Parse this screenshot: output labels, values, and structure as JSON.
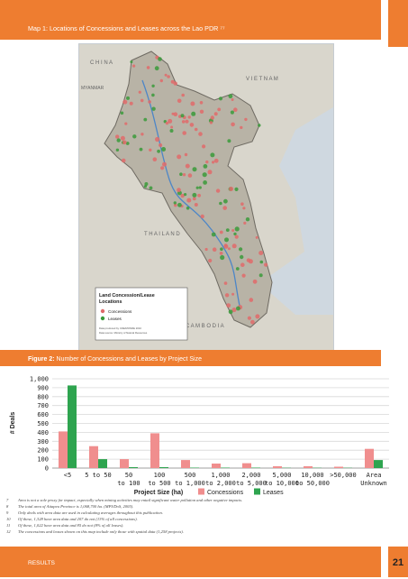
{
  "header": {
    "map_caption": "Map 1: Locations of Concessions and Leases across the Lao PDR ⁷⁷"
  },
  "map": {
    "labels": {
      "china": "C H I N A",
      "myanmar": "MYANMAR",
      "vietnam": "V I E T N A M",
      "thailand": "T H A I L A N D",
      "cambodia": "C A M B O D I A"
    },
    "legend": {
      "title_line1": "Land Concession/Lease",
      "title_line2": "Locations",
      "items": [
        {
          "label": "Concessions",
          "color": "#e06a6a"
        },
        {
          "label": "Leases",
          "color": "#3a9a3a"
        }
      ],
      "note1": "Data produced by CDE/MONRE 2010",
      "note2": "Data source: Ministry of Natural Resources"
    },
    "colors": {
      "land": "#eae3d2",
      "country": "#b8b3a6",
      "outline": "#6e6a62",
      "water": "#cfd8e0",
      "rivers": "#4d86c7",
      "concession": "#e06a6a",
      "lease": "#3a9a3a"
    }
  },
  "figure": {
    "label": "Figure 2:",
    "title": "Number of Concessions and Leases by Project Size"
  },
  "chart_data": {
    "type": "bar",
    "title": "",
    "xlabel": "Project Size (ha)",
    "ylabel": "# Deals",
    "ylim": [
      0,
      1000
    ],
    "yticks": [
      "0",
      "100",
      "200",
      "300",
      "400",
      "500",
      "600",
      "700",
      "800",
      "900",
      "1,000"
    ],
    "categories": [
      [
        "<5",
        ""
      ],
      [
        "5 to 50",
        ""
      ],
      [
        "50",
        "to 100"
      ],
      [
        "100",
        "to 500"
      ],
      [
        "500",
        "to 1,000"
      ],
      [
        "1,000",
        "to 2,000"
      ],
      [
        "2,000",
        "to 5,000"
      ],
      [
        "5,000",
        "to 10,000"
      ],
      [
        "10,000",
        "to 50,000"
      ],
      [
        ">50,000",
        ""
      ],
      [
        "Area",
        "Unknown"
      ]
    ],
    "series": [
      {
        "name": "Concessions",
        "color": "#f08e8e",
        "values": [
          410,
          245,
          100,
          390,
          90,
          50,
          55,
          20,
          20,
          15,
          215
        ]
      },
      {
        "name": "Leases",
        "color": "#2ea44f",
        "values": [
          925,
          100,
          10,
          10,
          5,
          5,
          5,
          3,
          3,
          3,
          90
        ]
      }
    ],
    "grid": true,
    "legend": "bottom"
  },
  "footnotes": [
    {
      "num": "7",
      "text": "Area is not a sole proxy for impact, especially when mining activities may entail significant water pollution and other negative impacts."
    },
    {
      "num": "8",
      "text": "The total area of Attapeu Province is 1,068,700 ha. (MPI/DoS, 2005)."
    },
    {
      "num": "9",
      "text": "Only deals with area data are used in calculating averages throughout this publication."
    },
    {
      "num": "10",
      "text": "Of these, 1,328 have area data and 207 do not (13% of all concessions)."
    },
    {
      "num": "11",
      "text": "Of these, 1,022 have area data and 85 do not (8% of all leases)."
    },
    {
      "num": "12",
      "text": "The concessions and leases shown on this map include only those with spatial data (1,258 projects)."
    }
  ],
  "footer": {
    "section": "RESULTS",
    "page": "21"
  }
}
